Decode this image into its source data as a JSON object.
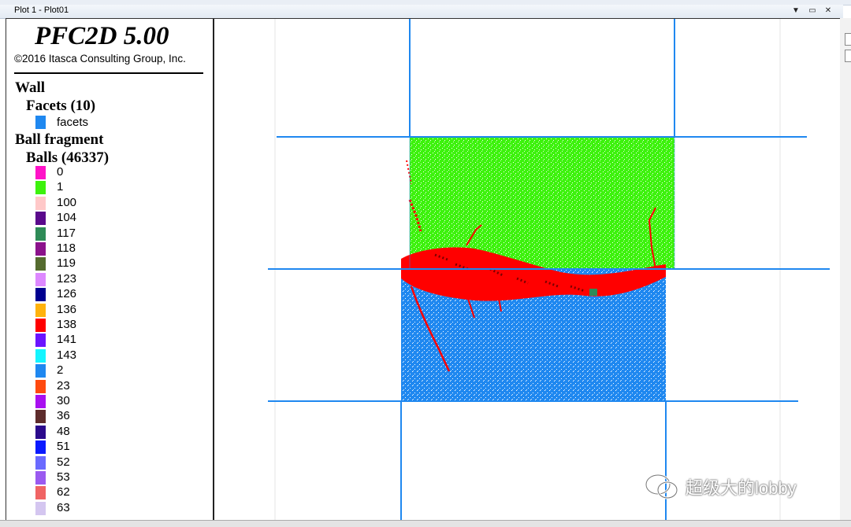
{
  "window": {
    "title": "Plot 1 - Plot01"
  },
  "legend": {
    "brand": "PFC2D 5.00",
    "copyright": "©2016 Itasca Consulting Group, Inc.",
    "wall": {
      "heading": "Wall",
      "facets_heading": "Facets (10)",
      "facets_label": "facets",
      "facets_color": "#1f88f0"
    },
    "balls": {
      "heading": "Ball fragment",
      "subheading": "Balls (46337)",
      "items": [
        {
          "label": "0",
          "color": "#ff13c8"
        },
        {
          "label": "1",
          "color": "#3df20d"
        },
        {
          "label": "100",
          "color": "#ffc8c8"
        },
        {
          "label": "104",
          "color": "#5a0a8c"
        },
        {
          "label": "117",
          "color": "#2e8b57"
        },
        {
          "label": "118",
          "color": "#8b128b"
        },
        {
          "label": "119",
          "color": "#556b2f"
        },
        {
          "label": "123",
          "color": "#dd88ff"
        },
        {
          "label": "126",
          "color": "#000090"
        },
        {
          "label": "136",
          "color": "#ffb20d"
        },
        {
          "label": "138",
          "color": "#ff0000"
        },
        {
          "label": "141",
          "color": "#6b14ff"
        },
        {
          "label": "143",
          "color": "#14f5ff"
        },
        {
          "label": "2",
          "color": "#1f88f0"
        },
        {
          "label": "23",
          "color": "#ff4a0f"
        },
        {
          "label": "30",
          "color": "#a80ff0"
        },
        {
          "label": "36",
          "color": "#5e2c2c"
        },
        {
          "label": "48",
          "color": "#2b0a8c"
        },
        {
          "label": "51",
          "color": "#0a1aff"
        },
        {
          "label": "52",
          "color": "#6a6aff"
        },
        {
          "label": "53",
          "color": "#9a5af0"
        },
        {
          "label": "62",
          "color": "#f06464"
        },
        {
          "label": "63",
          "color": "#d4c6f0"
        }
      ]
    }
  },
  "watermark": {
    "text": "超级大的lobby"
  },
  "colors": {
    "wall": "#1f88f0",
    "upper": "#3df20d",
    "lower": "#1f88f0",
    "crack": "#ff0000"
  }
}
